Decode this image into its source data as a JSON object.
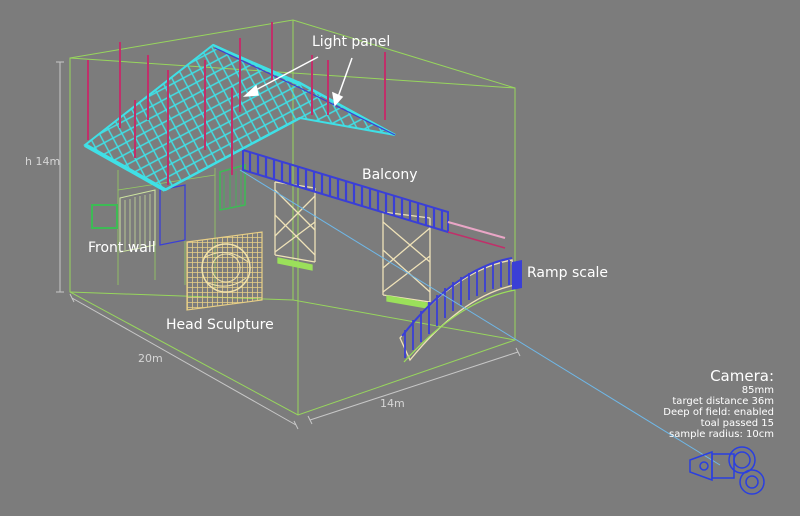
{
  "labels": {
    "light_panel": "Light panel",
    "balcony": "Balcony",
    "front_wall": "Front wall",
    "head_sculpture": "Head Sculpture",
    "ramp_scale": "Ramp scale"
  },
  "dimensions": {
    "height": "h 14m",
    "width": "20m",
    "depth": "14m"
  },
  "camera": {
    "title": "Camera:",
    "lines": [
      "85mm",
      "target distance 36m",
      "Deep of field: enabled",
      "toal passed 15",
      "sample radius: 10cm"
    ]
  },
  "colors": {
    "background": "#7c7c7c",
    "bounding_box": "#9be05a",
    "light_panel": "#3fe0e6",
    "posts": "#c0306a",
    "balcony": "#3a3fd6",
    "trusses": "#efe2b8",
    "sculpture": "#e8cf86",
    "camera": "#2a3fe0"
  }
}
